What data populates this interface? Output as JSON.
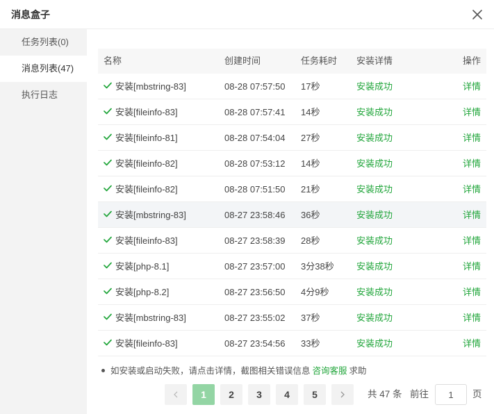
{
  "dialog": {
    "title": "消息盒子",
    "close_icon": "close-icon"
  },
  "sidebar": {
    "items": [
      {
        "label": "任务列表(0)"
      },
      {
        "label": "消息列表(47)"
      },
      {
        "label": "执行日志"
      }
    ],
    "active_index": 1
  },
  "table": {
    "columns": {
      "name": "名称",
      "created": "创建时间",
      "duration": "任务耗时",
      "detail": "安装详情",
      "action": "操作"
    },
    "rows": [
      {
        "name": "安装[mbstring-83]",
        "created": "08-28 07:57:50",
        "duration": "17秒",
        "status": "安装成功",
        "action": "详情"
      },
      {
        "name": "安装[fileinfo-83]",
        "created": "08-28 07:57:41",
        "duration": "14秒",
        "status": "安装成功",
        "action": "详情"
      },
      {
        "name": "安装[fileinfo-81]",
        "created": "08-28 07:54:04",
        "duration": "27秒",
        "status": "安装成功",
        "action": "详情"
      },
      {
        "name": "安装[fileinfo-82]",
        "created": "08-28 07:53:12",
        "duration": "14秒",
        "status": "安装成功",
        "action": "详情"
      },
      {
        "name": "安装[fileinfo-82]",
        "created": "08-28 07:51:50",
        "duration": "21秒",
        "status": "安装成功",
        "action": "详情"
      },
      {
        "name": "安装[mbstring-83]",
        "created": "08-27 23:58:46",
        "duration": "36秒",
        "status": "安装成功",
        "action": "详情"
      },
      {
        "name": "安装[fileinfo-83]",
        "created": "08-27 23:58:39",
        "duration": "28秒",
        "status": "安装成功",
        "action": "详情"
      },
      {
        "name": "安装[php-8.1]",
        "created": "08-27 23:57:00",
        "duration": "3分38秒",
        "status": "安装成功",
        "action": "详情"
      },
      {
        "name": "安装[php-8.2]",
        "created": "08-27 23:56:50",
        "duration": "4分9秒",
        "status": "安装成功",
        "action": "详情"
      },
      {
        "name": "安装[mbstring-83]",
        "created": "08-27 23:55:02",
        "duration": "37秒",
        "status": "安装成功",
        "action": "详情"
      },
      {
        "name": "安装[fileinfo-83]",
        "created": "08-27 23:54:56",
        "duration": "33秒",
        "status": "安装成功",
        "action": "详情"
      }
    ]
  },
  "tip": {
    "text": "如安装或启动失败，请点击详情，截图相关错误信息",
    "link": "咨询客服",
    "suffix": "求助"
  },
  "pagination": {
    "prev_icon": "chevron-left-icon",
    "next_icon": "chevron-right-icon",
    "pages": [
      "1",
      "2",
      "3",
      "4",
      "5"
    ],
    "current": "1",
    "total_text": "共 47 条",
    "goto_label": "前往",
    "goto_value": "1",
    "page_suffix": "页"
  },
  "colors": {
    "accent": "#20a53a",
    "active_page": "#93d5a4"
  }
}
